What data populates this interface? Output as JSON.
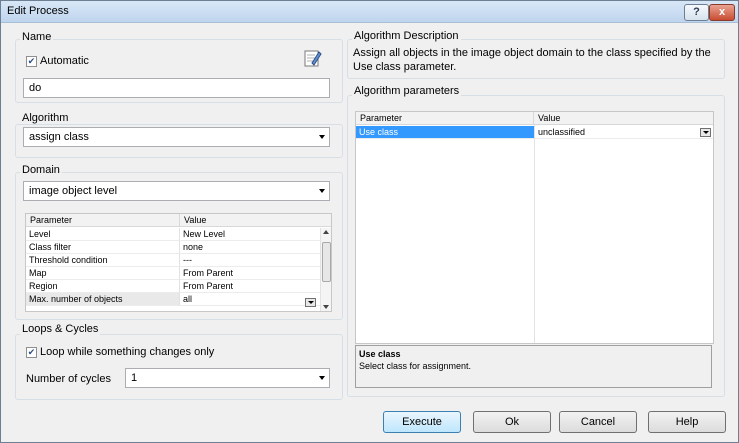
{
  "window": {
    "title": "Edit Process",
    "help_btn": "?",
    "close_btn": "x"
  },
  "name": {
    "group_label": "Name",
    "automatic_label": "Automatic",
    "automatic_checked": true,
    "value": "do"
  },
  "algorithm": {
    "group_label": "Algorithm",
    "selected": "assign class"
  },
  "domain": {
    "group_label": "Domain",
    "selected": "image object level",
    "grid_headers": [
      "Parameter",
      "Value"
    ],
    "rows": [
      {
        "param": "Level",
        "value": "New Level"
      },
      {
        "param": "Class filter",
        "value": "none"
      },
      {
        "param": "Threshold condition",
        "value": "---"
      },
      {
        "param": "Map",
        "value": "From Parent"
      },
      {
        "param": "Region",
        "value": "From Parent"
      },
      {
        "param": "Max. number of objects",
        "value": "all"
      }
    ]
  },
  "loops": {
    "group_label": "Loops & Cycles",
    "loop_label": "Loop while something changes only",
    "loop_checked": true,
    "cycles_label": "Number of cycles",
    "cycles_value": "1"
  },
  "description": {
    "group_label": "Algorithm Description",
    "text": "Assign all objects in the image object domain to the class specified by the Use class parameter."
  },
  "params": {
    "group_label": "Algorithm parameters",
    "grid_headers": [
      "Parameter",
      "Value"
    ],
    "rows": [
      {
        "param": "Use class",
        "value": "unclassified"
      }
    ],
    "info_title": "Use class",
    "info_text": "Select class for assignment."
  },
  "buttons": {
    "execute": "Execute",
    "ok": "Ok",
    "cancel": "Cancel",
    "help": "Help"
  },
  "colors": {
    "selection": "#3399ff",
    "title_bar": "#c5daf0",
    "close_button": "#c94c30"
  }
}
